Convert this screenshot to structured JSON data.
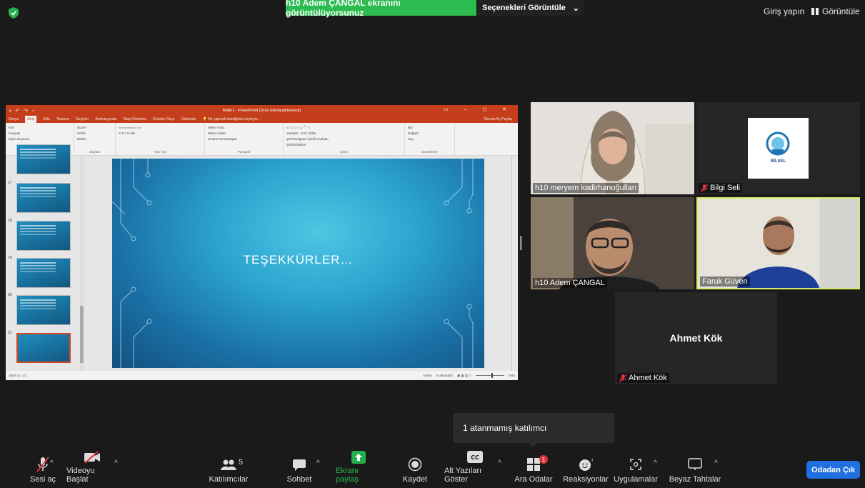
{
  "top": {
    "banner": "h10 Adem ÇANGAL ekranını görüntülüyorsunuz",
    "view_options": "Seçenekleri Görüntüle",
    "signin": "Giriş yapın",
    "view": "Görüntüle"
  },
  "ppt": {
    "title": "Bildiri1 - PowerPoint (Ürün Etkinleştirilemedi)",
    "tabs": [
      "Dosya",
      "Giriş",
      "Ekle",
      "Tasarım",
      "Geçişler",
      "Animasyonlar",
      "Slayt Gösterisi",
      "Gözden Geçir",
      "Görünüm"
    ],
    "search": "Ne yapmak istediğinizi söyleyin...",
    "signin_share": "Oturum Aç  Paylaş",
    "ribbon": {
      "paste": "Yapıştır",
      "cut": "Kes",
      "copy": "Kopyala",
      "format_painter": "Biçim Boyacısı",
      "new_slide": "Yeni Slayt",
      "layout": "Düzen",
      "reset": "Sıfırla",
      "section": "Bölüm",
      "text_direction": "Metin Yönü",
      "align_text": "Metni Hizala",
      "smartart": "SmartArt'a Dönüştür",
      "arrange": "Yerleştir",
      "quick_styles": "Hızlı Stiller",
      "shape_fill": "Şekil Dolgusu",
      "shape_outline": "Şekil Anahattı",
      "shape_effects": "Şekil Efektleri",
      "find": "Bul",
      "replace": "Değiştir",
      "select": "Seç",
      "groups": [
        "Pano",
        "Slaytlar",
        "Yazı Tipi",
        "Paragraf",
        "Çizim",
        "Düzenleme"
      ]
    },
    "thumb_numbers": [
      "17",
      "18",
      "19",
      "20",
      "21"
    ],
    "slide_title": "TEŞEKKÜRLER…",
    "status_left": "Slayt 21 / 21",
    "notes": "Notlar",
    "comments": "Açıklamalar",
    "zoom": "%66"
  },
  "participants": {
    "p1": "h10 meryem kadirhanoğulları",
    "p2": "Bilgi Seli",
    "p3": "h10 Adem ÇANGAL",
    "p4": "Faruk Güven",
    "p5": "Ahmet Kök",
    "p5_big": "Ahmet Kök",
    "logo_text": "BİLSEL"
  },
  "tooltip": "1 atanmamış katılımcı",
  "toolbar": {
    "unmute": "Sesi aç",
    "start_video": "Videoyu Başlat",
    "participants": "Katılımcılar",
    "participant_count": "5",
    "chat": "Sohbet",
    "share_screen": "Ekranı paylaş",
    "record": "Kaydet",
    "captions": "Alt Yazıları Göster",
    "breakout": "Ara Odalar",
    "breakout_badge": "1",
    "reactions": "Reaksiyonlar",
    "apps": "Uygulamalar",
    "whiteboard": "Beyaz Tahtalar",
    "leave": "Odadan Çık"
  },
  "colors": {
    "banner": "#2bbb4e",
    "leave": "#1f6fe0",
    "active_speaker": "#d8eb6e",
    "ppt_red": "#c43e1c"
  }
}
